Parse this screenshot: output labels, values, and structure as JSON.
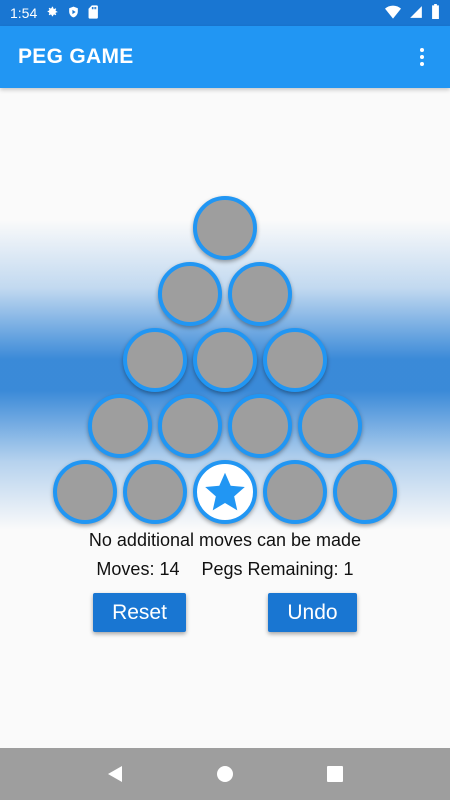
{
  "status_bar": {
    "time": "1:54",
    "icons": [
      "gear-icon",
      "shield-icon",
      "sd-card-icon",
      "wifi-icon",
      "signal-icon",
      "battery-icon"
    ]
  },
  "app_bar": {
    "title": "PEG GAME",
    "menu_icon": "more-vert-icon"
  },
  "board": {
    "rows": [
      [
        "peg"
      ],
      [
        "peg",
        "peg"
      ],
      [
        "peg",
        "peg",
        "peg"
      ],
      [
        "peg",
        "peg",
        "peg",
        "peg"
      ],
      [
        "peg",
        "peg",
        "empty",
        "peg",
        "peg"
      ]
    ],
    "empty_icon": "star-icon"
  },
  "game": {
    "message": "No additional moves can be made",
    "moves_label": "Moves: 14",
    "pegs_label": "Pegs Remaining: 1"
  },
  "buttons": {
    "reset": "Reset",
    "undo": "Undo"
  },
  "colors": {
    "primary": "#2196f3",
    "primary_dark": "#1976d2",
    "peg": "#9e9e9e"
  },
  "nav_bar": {
    "icons": [
      "back-icon",
      "home-icon",
      "recents-icon"
    ]
  }
}
